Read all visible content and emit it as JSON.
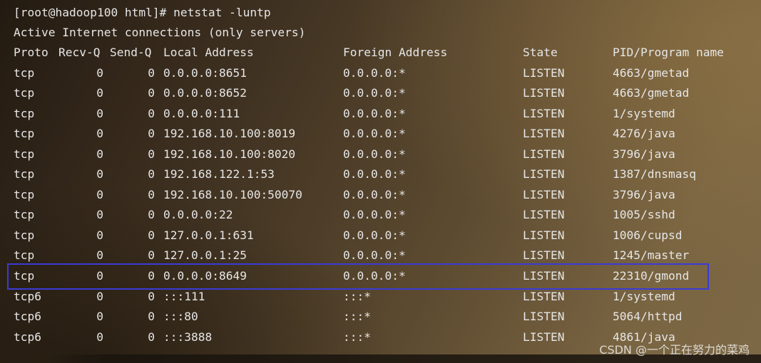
{
  "terminal": {
    "prompt_line": "[root@hadoop100 html]# netstat -luntp",
    "info_line": "Active Internet connections (only servers)",
    "headers": {
      "proto": "Proto",
      "recvq": "Recv-Q",
      "sendq": "Send-Q",
      "local": "Local Address",
      "foreign": "Foreign Address",
      "state": "State",
      "pid": "PID/Program name"
    },
    "rows": [
      {
        "proto": "tcp",
        "recvq": "0",
        "sendq": "0",
        "local": "0.0.0.0:8651",
        "foreign": "0.0.0.0:*",
        "state": "LISTEN",
        "pid": "4663/gmetad"
      },
      {
        "proto": "tcp",
        "recvq": "0",
        "sendq": "0",
        "local": "0.0.0.0:8652",
        "foreign": "0.0.0.0:*",
        "state": "LISTEN",
        "pid": "4663/gmetad"
      },
      {
        "proto": "tcp",
        "recvq": "0",
        "sendq": "0",
        "local": "0.0.0.0:111",
        "foreign": "0.0.0.0:*",
        "state": "LISTEN",
        "pid": "1/systemd"
      },
      {
        "proto": "tcp",
        "recvq": "0",
        "sendq": "0",
        "local": "192.168.10.100:8019",
        "foreign": "0.0.0.0:*",
        "state": "LISTEN",
        "pid": "4276/java"
      },
      {
        "proto": "tcp",
        "recvq": "0",
        "sendq": "0",
        "local": "192.168.10.100:8020",
        "foreign": "0.0.0.0:*",
        "state": "LISTEN",
        "pid": "3796/java"
      },
      {
        "proto": "tcp",
        "recvq": "0",
        "sendq": "0",
        "local": "192.168.122.1:53",
        "foreign": "0.0.0.0:*",
        "state": "LISTEN",
        "pid": "1387/dnsmasq"
      },
      {
        "proto": "tcp",
        "recvq": "0",
        "sendq": "0",
        "local": "192.168.10.100:50070",
        "foreign": "0.0.0.0:*",
        "state": "LISTEN",
        "pid": "3796/java"
      },
      {
        "proto": "tcp",
        "recvq": "0",
        "sendq": "0",
        "local": "0.0.0.0:22",
        "foreign": "0.0.0.0:*",
        "state": "LISTEN",
        "pid": "1005/sshd"
      },
      {
        "proto": "tcp",
        "recvq": "0",
        "sendq": "0",
        "local": "127.0.0.1:631",
        "foreign": "0.0.0.0:*",
        "state": "LISTEN",
        "pid": "1006/cupsd"
      },
      {
        "proto": "tcp",
        "recvq": "0",
        "sendq": "0",
        "local": "127.0.0.1:25",
        "foreign": "0.0.0.0:*",
        "state": "LISTEN",
        "pid": "1245/master"
      },
      {
        "proto": "tcp",
        "recvq": "0",
        "sendq": "0",
        "local": "0.0.0.0:8649",
        "foreign": "0.0.0.0:*",
        "state": "LISTEN",
        "pid": "22310/gmond"
      },
      {
        "proto": "tcp6",
        "recvq": "0",
        "sendq": "0",
        "local": ":::111",
        "foreign": ":::*",
        "state": "LISTEN",
        "pid": "1/systemd"
      },
      {
        "proto": "tcp6",
        "recvq": "0",
        "sendq": "0",
        "local": ":::80",
        "foreign": ":::*",
        "state": "LISTEN",
        "pid": "5064/httpd"
      },
      {
        "proto": "tcp6",
        "recvq": "0",
        "sendq": "0",
        "local": ":::3888",
        "foreign": ":::*",
        "state": "LISTEN",
        "pid": "4861/java"
      }
    ]
  },
  "highlight": {
    "color": "#3a3ad8"
  },
  "watermark": {
    "text": "CSDN @一个正在努力的菜鸡"
  }
}
